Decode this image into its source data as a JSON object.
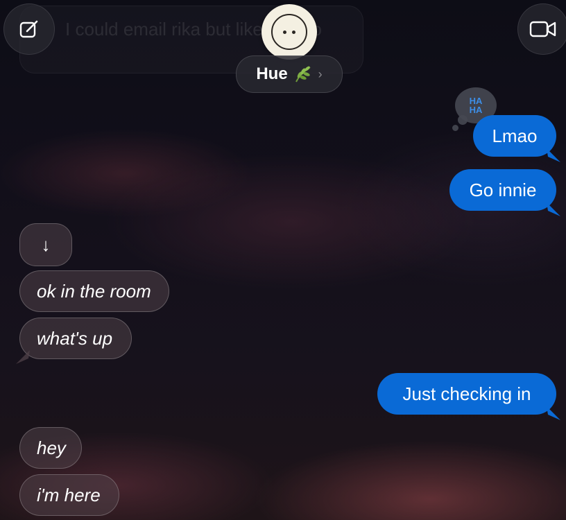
{
  "header": {
    "contact_name": "Hue",
    "contact_emoji": "🌿",
    "chevron": "›"
  },
  "ghost_message": "I could email rika but like bad so",
  "tapback": {
    "line1": "HA",
    "line2": "HA"
  },
  "scroll_arrow": "↓",
  "messages": [
    {
      "text": "Lmao",
      "from": "me"
    },
    {
      "text": "Go innie",
      "from": "me"
    },
    {
      "text": "ok in the room",
      "from": "them"
    },
    {
      "text": "what's up",
      "from": "them"
    },
    {
      "text": "Just checking in",
      "from": "me"
    },
    {
      "text": "hey",
      "from": "them"
    },
    {
      "text": "i'm here",
      "from": "them"
    }
  ],
  "colors": {
    "sent_bubble": "#0a6ad6",
    "tapback_text": "#3d8fe8",
    "avatar_bg": "#f4f0e2"
  },
  "icons": {
    "compose": "compose-icon",
    "video": "video-camera-icon",
    "leaf": "leaf-icon"
  }
}
